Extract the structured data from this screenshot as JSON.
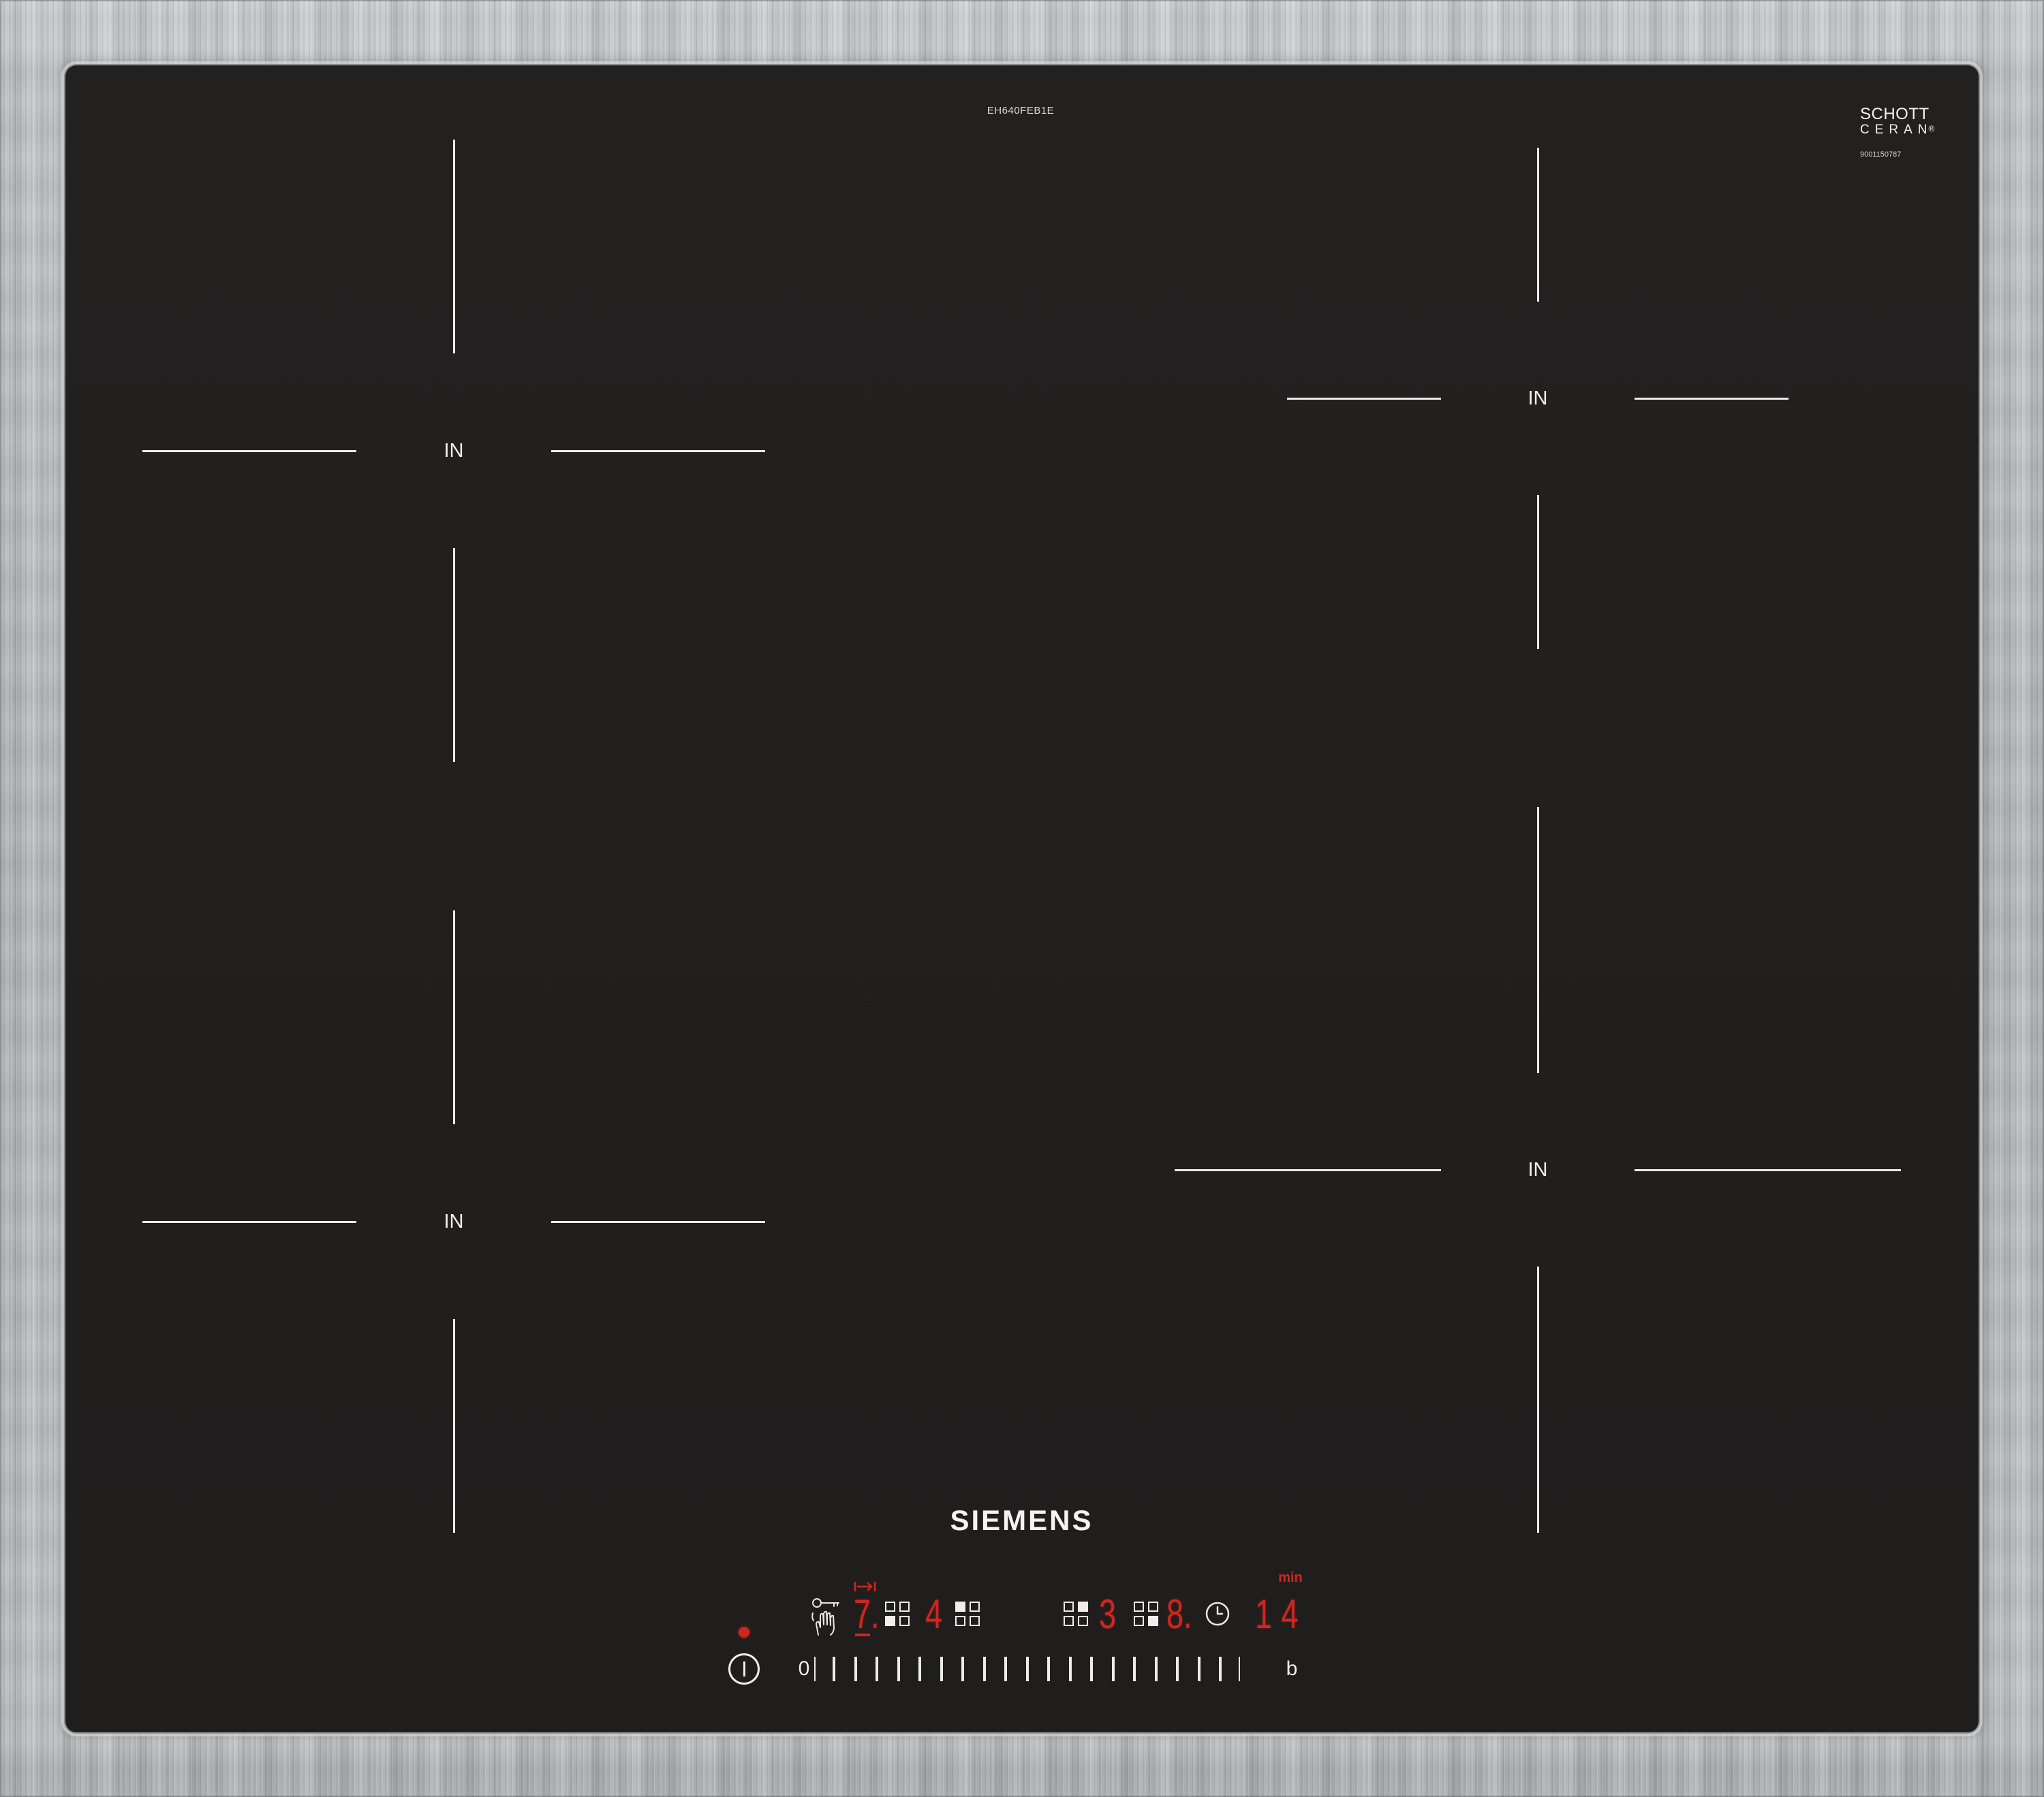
{
  "hob": {
    "model_number": "EH640FEB1E",
    "brand": "SIEMENS",
    "glass_logo": {
      "line1": "SCHOTT",
      "line2": "CERAN",
      "registered_mark": "®",
      "code": "9001150787"
    }
  },
  "zones": [
    {
      "label": "IN"
    },
    {
      "label": "IN"
    },
    {
      "label": "IN"
    },
    {
      "label": "IN"
    }
  ],
  "display": {
    "zones": [
      {
        "level": "7.",
        "active_cell": 2
      },
      {
        "level": "4",
        "active_cell": 0
      },
      {
        "level": "3",
        "active_cell": 1
      },
      {
        "level": "8.",
        "active_cell": 3
      }
    ],
    "timer": {
      "unit": "min",
      "value": "14"
    }
  },
  "slider": {
    "min_label": "0",
    "max_label": "b",
    "steps": 19
  },
  "icons": {
    "lock": "childlock-wipe-protection-icon",
    "move": "move-arrow-icon",
    "clock": "clock-icon",
    "power": "power-icon",
    "led": "status-led-icon"
  },
  "colors": {
    "glass": "#201e1d",
    "display_red": "#d1261f",
    "print_white": "#eeeeee",
    "steel": "#b8bbbd"
  }
}
